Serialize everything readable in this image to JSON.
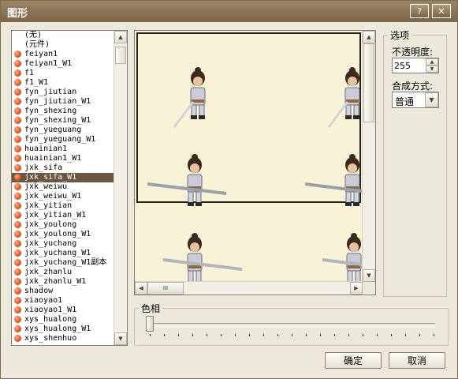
{
  "window": {
    "title": "图形",
    "help_label": "?",
    "close_label": "✕"
  },
  "list": {
    "items": [
      {
        "label": "(无)",
        "dot": false
      },
      {
        "label": "(元件)",
        "dot": false
      },
      {
        "label": "feiyan1",
        "dot": true
      },
      {
        "label": "feiyan1_W1",
        "dot": true
      },
      {
        "label": "f1",
        "dot": true
      },
      {
        "label": "f1_W1",
        "dot": true
      },
      {
        "label": "fyn_jiutian",
        "dot": true
      },
      {
        "label": "fyn_jiutian_W1",
        "dot": true
      },
      {
        "label": "fyn_shexing",
        "dot": true
      },
      {
        "label": "fyn_shexing_W1",
        "dot": true
      },
      {
        "label": "fyn_yueguang",
        "dot": true
      },
      {
        "label": "fyn_yueguang_W1",
        "dot": true
      },
      {
        "label": "huainian1",
        "dot": true
      },
      {
        "label": "huainian1_W1",
        "dot": true
      },
      {
        "label": "jxk_sifa",
        "dot": true
      },
      {
        "label": "jxk_sifa_W1",
        "dot": true,
        "selected": true
      },
      {
        "label": "jxk_weiwu",
        "dot": true
      },
      {
        "label": "jxk_weiwu_W1",
        "dot": true
      },
      {
        "label": "jxk_yitian",
        "dot": true
      },
      {
        "label": "jxk_yitian_W1",
        "dot": true
      },
      {
        "label": "jxk_youlong",
        "dot": true
      },
      {
        "label": "jxk_youlong_W1",
        "dot": true
      },
      {
        "label": "jxk_yuchang",
        "dot": true
      },
      {
        "label": "jxk_yuchang_W1",
        "dot": true
      },
      {
        "label": "jxk_yuchang_W1副本",
        "dot": true
      },
      {
        "label": "jxk_zhanlu",
        "dot": true
      },
      {
        "label": "jxk_zhanlu_W1",
        "dot": true
      },
      {
        "label": "shadow",
        "dot": true
      },
      {
        "label": "xiaoyao1",
        "dot": true
      },
      {
        "label": "xiaoyao1_W1",
        "dot": true
      },
      {
        "label": "xys_hualong",
        "dot": true
      },
      {
        "label": "xys_hualong_W1",
        "dot": true
      },
      {
        "label": "xys_shenhuo",
        "dot": true
      }
    ]
  },
  "options": {
    "group_label": "选项",
    "opacity_label": "不透明度:",
    "opacity_value": "255",
    "blend_label": "合成方式:",
    "blend_value": "普通"
  },
  "hue": {
    "group_label": "色相",
    "value": 0
  },
  "buttons": {
    "ok": "确定",
    "cancel": "取消"
  },
  "scrollbar": {
    "hscroll_thumb_label": "III",
    "up": "▲",
    "down": "▼",
    "left": "◀",
    "right": "▶"
  },
  "colors": {
    "title_bar": "#8c7558",
    "selection": "#6b5640",
    "preview_bg": "#f8f2d6",
    "list_dot": "#e2531f"
  }
}
